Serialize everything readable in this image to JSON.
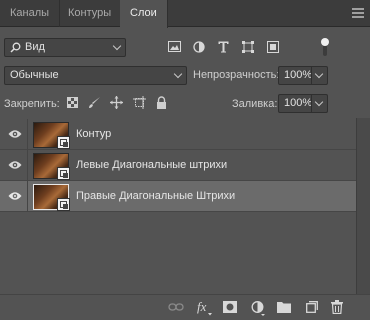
{
  "tabs": [
    {
      "label": "Каналы",
      "active": false
    },
    {
      "label": "Контуры",
      "active": false
    },
    {
      "label": "Слои",
      "active": true
    }
  ],
  "filter": {
    "kind_label": "Вид"
  },
  "blend": {
    "mode": "Обычные",
    "opacity_label": "Непрозрачность:",
    "opacity_value": "100%"
  },
  "lock": {
    "label": "Закрепить:",
    "fill_label": "Заливка:",
    "fill_value": "100%"
  },
  "layers": [
    {
      "name": "Контур",
      "visible": true,
      "selected": false
    },
    {
      "name": "Левые Диагональные штрихи",
      "visible": true,
      "selected": false
    },
    {
      "name": "Правые Диагональные Штрихи",
      "visible": true,
      "selected": true
    }
  ],
  "bottom_icons": [
    "link-layers-icon",
    "fx-icon",
    "add-mask-icon",
    "adjustment-layer-icon",
    "new-group-icon",
    "new-layer-icon",
    "delete-layer-icon"
  ],
  "colors": {
    "panel": "#535353",
    "tabbar": "#3c3c3c",
    "selected_row": "#6b6b6b",
    "field": "#454545"
  }
}
